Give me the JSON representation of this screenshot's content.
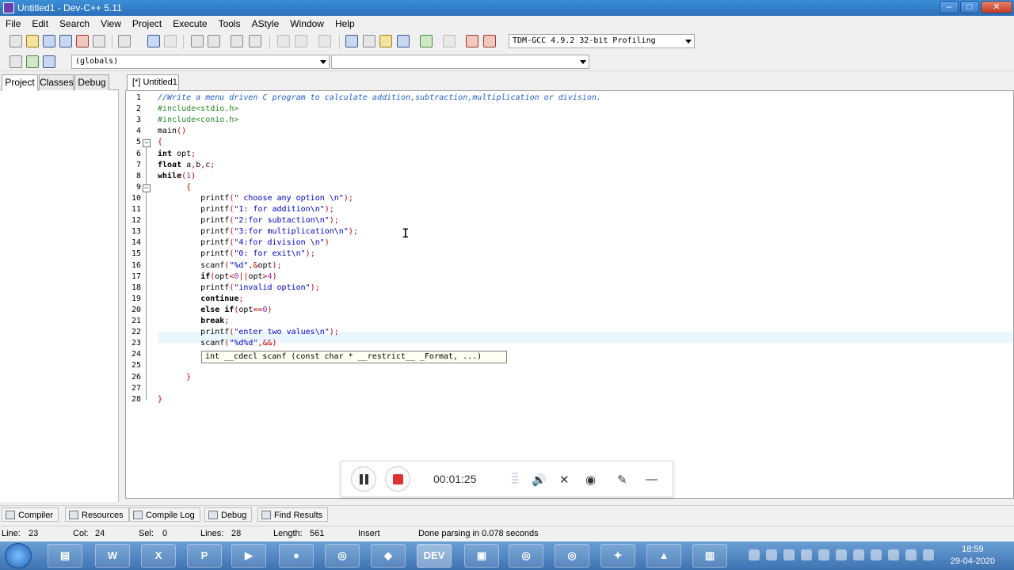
{
  "window": {
    "title": "Untitled1 - Dev-C++ 5.11"
  },
  "menu": [
    "File",
    "Edit",
    "Search",
    "View",
    "Project",
    "Execute",
    "Tools",
    "AStyle",
    "Window",
    "Help"
  ],
  "compiler_select": "TDM-GCC 4.9.2 32-bit Profiling",
  "scope_select": "(globals)",
  "member_select": "",
  "left_tabs": [
    "Project",
    "Classes",
    "Debug"
  ],
  "editor_tab": "[*] Untitled1",
  "code_lines": [
    "//Write a menu driven C program to calculate addition,subtraction,multiplication or division.",
    "#include<stdio.h>",
    "#include<conio.h>",
    "main()",
    "{",
    "int opt;",
    "float a,b,c;",
    "while(1)",
    "      {",
    "         printf(\" choose any option \\n\");",
    "         printf(\"1: for addition\\n\");",
    "         printf(\"2:for subtaction\\n\");",
    "         printf(\"3:for multiplication\\n\");",
    "         printf(\"4:for division \\n\")",
    "         printf(\"0: for exit\\n\");",
    "         scanf(\"%d\",&opt);",
    "         if(opt<0||opt>4)",
    "         printf(\"invalid option\");",
    "         continue;",
    "         else if(opt==0)",
    "         break;",
    "         printf(\"enter two values\\n\");",
    "         scanf(\"%d%d\",&&)",
    "",
    "",
    "      }",
    "",
    "}"
  ],
  "calltip": "int __cdecl scanf (const char * __restrict__ _Format, ...)",
  "recorder": {
    "time": "00:01:25"
  },
  "bottom_tabs": [
    "Compiler",
    "Resources",
    "Compile Log",
    "Debug",
    "Find Results"
  ],
  "status": {
    "line_label": "Line:",
    "line_value": "23",
    "col_label": "Col:",
    "col_value": "24",
    "sel_label": "Sel:",
    "sel_value": "0",
    "lines_label": "Lines:",
    "lines_value": "28",
    "length_label": "Length:",
    "length_value": "561",
    "mode": "Insert",
    "message": "Done parsing in 0.078 seconds"
  },
  "taskbar": {
    "time": "18:59",
    "date": "29-04-2020",
    "apps": [
      "explorer",
      "word",
      "excel",
      "powerpoint",
      "media-player",
      "firefox",
      "chrome",
      "app-red",
      "dev-cpp",
      "app-grey",
      "chrome-2",
      "chrome-3",
      "app-orange",
      "vlc",
      "app-blue"
    ]
  },
  "icons": {
    "file": "file-icon",
    "save": "save-icon",
    "compile": "compile-icon",
    "run": "run-icon",
    "pause": "pause-icon",
    "stop": "stop-icon",
    "volume": "volume-icon",
    "mic-off": "mic-off-icon",
    "camera": "camera-icon",
    "pen": "pen-icon",
    "minimize": "minimize-icon"
  },
  "colors": {
    "titlebar": "#2b6fb8",
    "comment": "#1e5fcf",
    "preprocessor": "#2a8a2a",
    "string": "#0000c8",
    "current_line": "#eaf7ff",
    "record": "#e03030"
  }
}
